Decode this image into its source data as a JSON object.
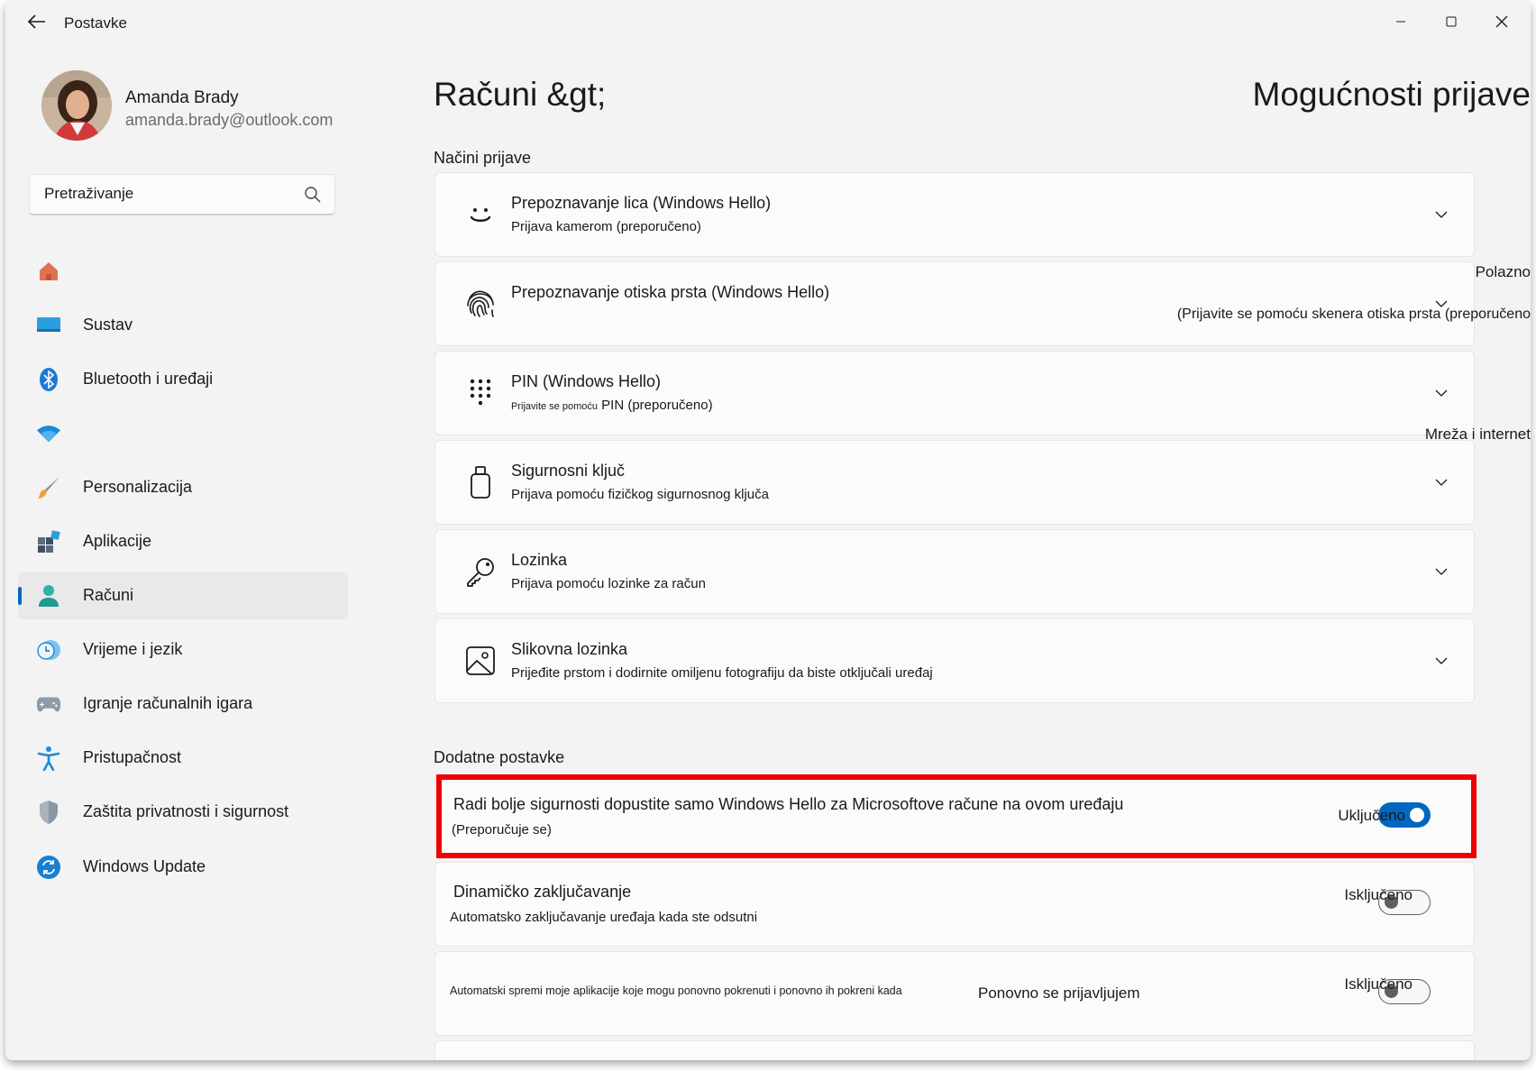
{
  "window": {
    "title": "Postavke"
  },
  "user": {
    "name": "Amanda Brady",
    "email": "amanda.brady@outlook.com"
  },
  "search": {
    "placeholder": "Pretraživanje"
  },
  "nav": {
    "items": [
      {
        "label": "",
        "icon": "home-icon"
      },
      {
        "label": "Sustav",
        "icon": "monitor-icon"
      },
      {
        "label": "Bluetooth i uređaji",
        "icon": "bluetooth-icon"
      },
      {
        "label": "",
        "icon": "wifi-icon"
      },
      {
        "label": "Personalizacija",
        "icon": "brush-icon"
      },
      {
        "label": "Aplikacije",
        "icon": "apps-icon"
      },
      {
        "label": "Računi",
        "icon": "person-icon",
        "active": true
      },
      {
        "label": "Vrijeme i jezik",
        "icon": "clock-globe-icon"
      },
      {
        "label": "Igranje računalnih igara",
        "icon": "gamepad-icon"
      },
      {
        "label": "Pristupačnost",
        "icon": "accessibility-icon"
      },
      {
        "label": "Zaštita privatnosti i sigurnost",
        "icon": "shield-icon"
      },
      {
        "label": "Windows Update",
        "icon": "update-icon"
      }
    ]
  },
  "main": {
    "breadcrumb_parent": "Računi &gt;",
    "breadcrumb_current": "Mogućnosti prijave",
    "signin_section": "Načini prijave",
    "signin_methods": [
      {
        "title": "Prepoznavanje lica (Windows Hello)",
        "subtitle": "Prijava kamerom (preporučeno)",
        "icon": "face-icon"
      },
      {
        "title": "Prepoznavanje otiska prsta (Windows Hello)",
        "subtitle": "",
        "icon": "fingerprint-icon"
      },
      {
        "title": "PIN (Windows Hello)",
        "subtitle_small": "Prijavite se pomoću",
        "subtitle": "PIN (preporučeno)",
        "icon": "pin-keypad-icon"
      },
      {
        "title": "Sigurnosni ključ",
        "subtitle": "Prijava pomoću fizičkog sigurnosnog ključa",
        "icon": "usb-key-icon"
      },
      {
        "title": "Lozinka",
        "subtitle": "Prijava pomoću lozinke za račun",
        "icon": "key-icon"
      },
      {
        "title": "Slikovna lozinka",
        "subtitle": "Prijeđite prstom i dodirnite omiljenu fotografiju da biste otključali uređaj",
        "icon": "picture-icon"
      }
    ],
    "overflow": {
      "polazno": "Polazno",
      "fingerprint_sub": "(Prijavite se pomoću skenera otiska prsta (preporučeno",
      "mreza": "Mreža i internet"
    },
    "additional_section": "Dodatne postavke",
    "settings": [
      {
        "title": "Radi bolje sigurnosti dopustite samo Windows Hello za Microsoftove račune na ovom uređaju",
        "subtitle": "(Preporučuje se)",
        "state": "Uključeno",
        "on": true
      },
      {
        "title": "Dinamičko zaključavanje",
        "subtitle": "Automatsko zaključavanje uređaja kada ste odsutni",
        "state": "Isključeno",
        "on": false
      },
      {
        "title": "Automatski spremi moje aplikacije koje mogu ponovno pokrenuti i ponovno ih pokreni kada",
        "title2": "Ponovno se prijavljujem",
        "state": "Isključeno",
        "on": false
      }
    ]
  },
  "colors": {
    "accent": "#0067c0",
    "highlight": "#ee0000",
    "window_bg": "#f3f3f3",
    "card_bg": "#fbfbfb"
  }
}
